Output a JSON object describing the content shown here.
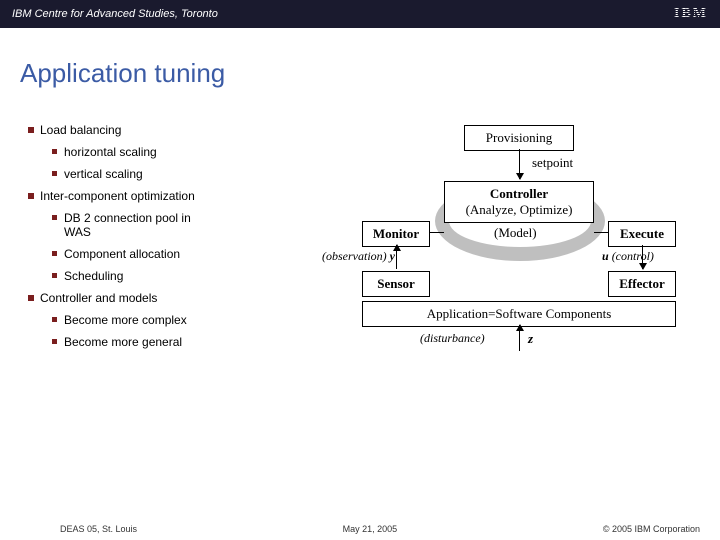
{
  "header": {
    "title": "IBM Centre for Advanced Studies, Toronto",
    "logo": "IBM"
  },
  "slide": {
    "title": "Application tuning"
  },
  "bullets": {
    "b1": "Load balancing",
    "b1a": " horizontal scaling",
    "b1b": "vertical scaling",
    "b2": "Inter-component optimization",
    "b2a": "DB 2 connection pool in WAS",
    "b2b": "Component allocation",
    "b2c": "Scheduling",
    "b3": "Controller and models",
    "b3a": "Become more complex",
    "b3b": "Become more general"
  },
  "diagram": {
    "provisioning": "Provisioning",
    "setpoint": "setpoint",
    "controller": "Controller",
    "controller_sub": "(Analyze, Optimize)",
    "monitor": "Monitor",
    "model": "(Model)",
    "execute": "Execute",
    "obs_y": "(observation)",
    "y": "y",
    "u": "u",
    "control": "(control)",
    "sensor": "Sensor",
    "effector": "Effector",
    "application": "Application=Software Components",
    "disturbance": "(disturbance)",
    "z": "z"
  },
  "footer": {
    "left": "DEAS 05, St. Louis",
    "center": "May 21, 2005",
    "right": "© 2005 IBM Corporation"
  }
}
